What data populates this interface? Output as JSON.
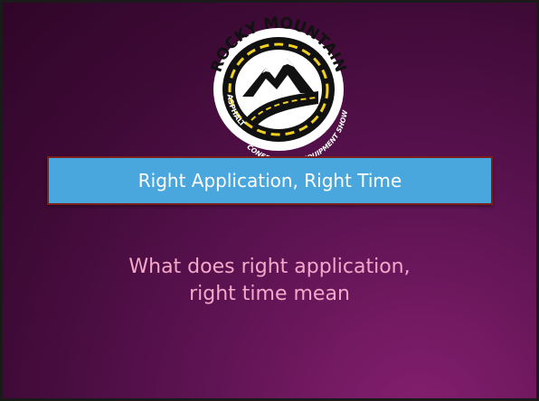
{
  "slide": {
    "logo": {
      "top_text": "ROCKY MOUNTAIN",
      "left_text": "ASPHALT",
      "bottom_text": "CONFERENCE & EQUIPMENT SHOW"
    },
    "title": "Right Application, Right Time",
    "body": [
      "What does right application,",
      "right time mean"
    ]
  },
  "colors": {
    "background": "#4a0d42",
    "banner": "#49a7dd",
    "banner_border": "#7a1f1a",
    "title_text": "#ffffff",
    "body_text": "#f4a7c9"
  }
}
